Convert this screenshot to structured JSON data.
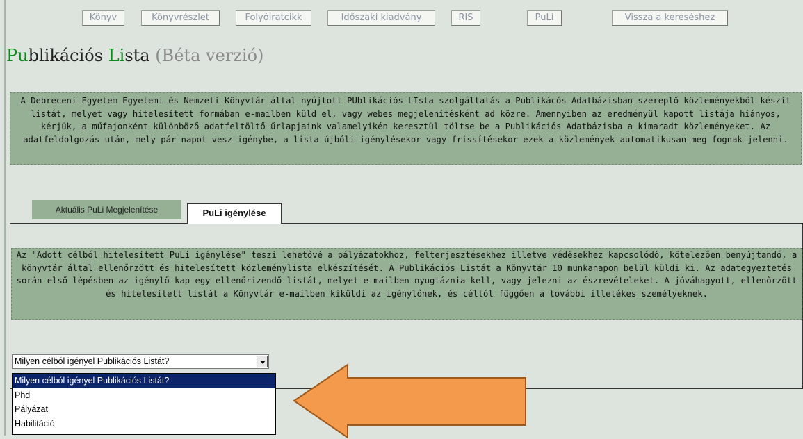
{
  "nav": {
    "buttons": [
      "Könyv",
      "Könyvrészlet",
      "Folyóiratcikk",
      "Időszaki kiadvány",
      "RIS",
      "PuLi",
      "Vissza a kereséshez"
    ]
  },
  "title": {
    "pu_green": "Pu",
    "blikacios": "blikációs ",
    "li_green": "Li",
    "sta": "sta",
    "beta": " (Béta verzió)"
  },
  "intro_text": "A Debreceni Egyetem Egyetemi és Nemzeti Könyvtár által nyújtott PUblikációs LIsta szolgáltatás a Publikácós Adatbázisban szereplő közleményekből készít listát, melyet vagy hitelesített formában e-mailben küld el, vagy webes megjelenítésként ad közre. Amennyiben az eredményül kapott listája hiányos, kérjük, a műfajonként különböző adatfeltöltő űrlapjaink valamelyikén keresztül töltse be a Publikációs Adatbázisba a kimaradt közleményeket. Az adatfeldolgozás után, mely pár napot vesz igénybe, a lista újbóli igénylésekor vagy frissítésekor ezek a közlemények automatikusan meg fognak jelenni.",
  "tabs": {
    "inactive": "Aktuális PuLi Megjelenítése",
    "active": "PuLi igénylése"
  },
  "panel_text": "Az \"Adott célból hitelesített PuLi igénylése\" teszi lehetővé a pályázatokhoz, felterjesztésekhez illetve védésekhez kapcsolódó, kötelezően benyújtandó, a könyvtár által ellenőrzött és hitelesített közleménylista elkészítését. A Publikációs Listát a Könyvtár 10 munkanapon belül küldi ki. Az adategyeztetés során első lépésben az igénylő kap egy ellenőrizendő listát, melyet e-mailben nyugtáznia kell, vagy jelezni az észrevételeket. A jóváhagyott, ellenőrzött és hitelesített listát a Könyvtár e-mailben kiküldi az igénylőnek, és céltól függően a további illetékes személyeknek.",
  "select": {
    "value": "Milyen célból igényel Publikációs Listát?",
    "options": [
      "Milyen célból igényel Publikációs Listát?",
      "Phd",
      "Pályázat",
      "Habilitáció"
    ],
    "selected_index": 0
  },
  "colors": {
    "background": "#dde4dd",
    "box_green": "#96b096",
    "title_green": "#0f8a1e",
    "arrow_orange": "#f39a4c",
    "selected_option": "#0b246a"
  }
}
